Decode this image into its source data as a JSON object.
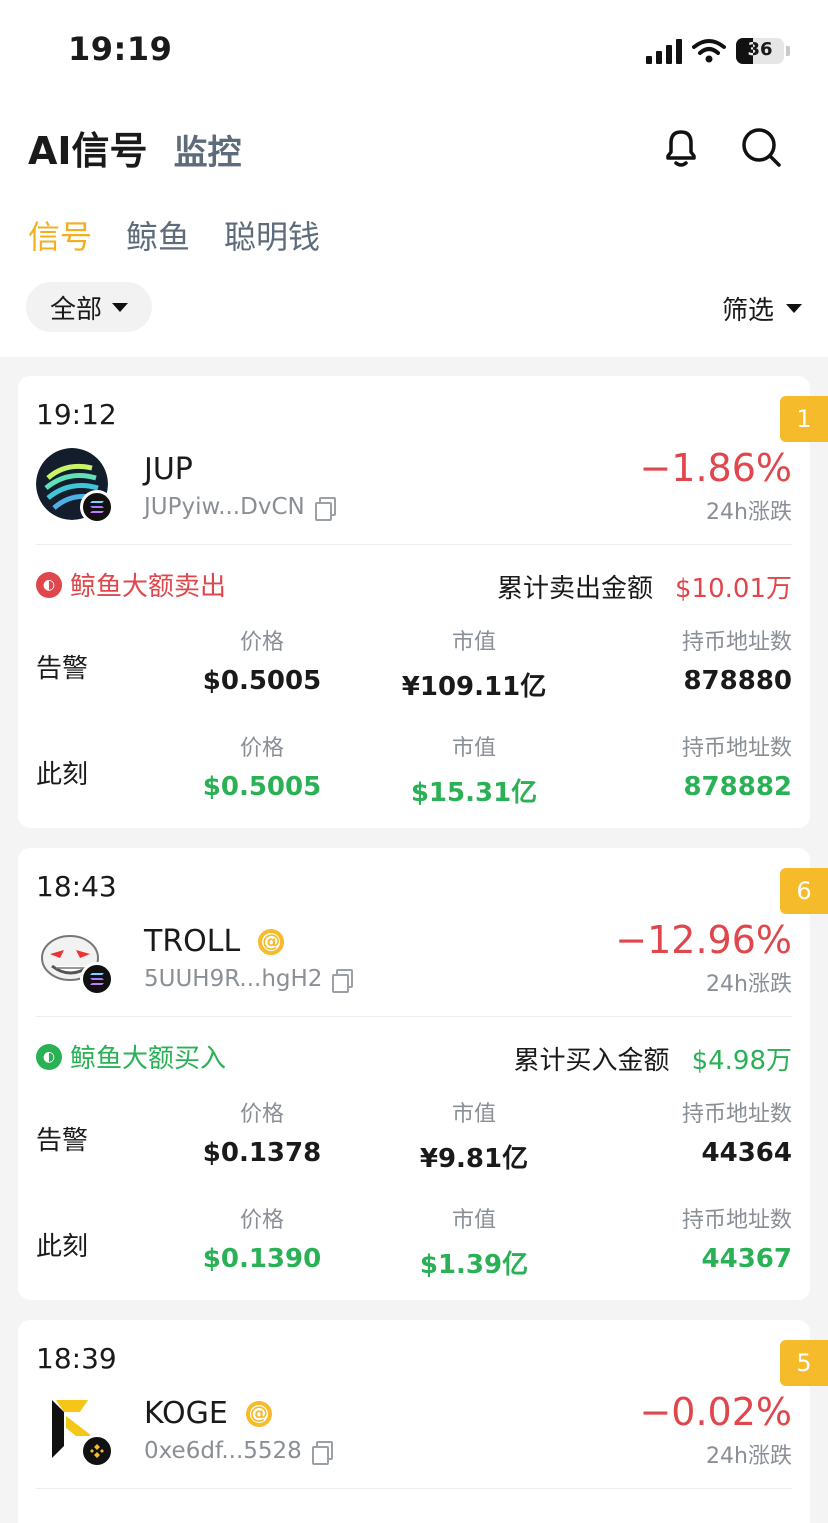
{
  "status_bar": {
    "time": "19:19",
    "battery": "36"
  },
  "header": {
    "title": "AI信号",
    "title_secondary": "监控"
  },
  "tabs": [
    {
      "label": "信号",
      "active": true
    },
    {
      "label": "鲸鱼"
    },
    {
      "label": "聪明钱"
    }
  ],
  "filter": {
    "scope": "全部",
    "filter_label": "筛选"
  },
  "colors": {
    "accent": "#f2b01e",
    "down": "#e0474c",
    "up": "#2ab155",
    "muted": "#8a8f96"
  },
  "cards": [
    {
      "time": "19:12",
      "badge": "1",
      "symbol": "JUP",
      "address": "JUPyiw...DvCN",
      "change": "−1.86%",
      "change_label": "24h涨跌",
      "alert_label": "鲸鱼大额卖出",
      "sum_label": "累计卖出金额",
      "sum_value": "$10.01万",
      "alert_row": {
        "label": "告警",
        "price_h": "价格",
        "price": "$0.5005",
        "mcap_h": "市值",
        "mcap": "¥109.11亿",
        "holders_h": "持币地址数",
        "holders": "878880"
      },
      "now_row": {
        "label": "此刻",
        "price_h": "价格",
        "price": "$0.5005",
        "mcap_h": "市值",
        "mcap": "$15.31亿",
        "holders_h": "持币地址数",
        "holders": "878882"
      }
    },
    {
      "time": "18:43",
      "badge": "6",
      "symbol": "TROLL",
      "address": "5UUH9R...hgH2",
      "change": "−12.96%",
      "change_label": "24h涨跌",
      "alert_label": "鲸鱼大额买入",
      "sum_label": "累计买入金额",
      "sum_value": "$4.98万",
      "alert_row": {
        "label": "告警",
        "price_h": "价格",
        "price": "$0.1378",
        "mcap_h": "市值",
        "mcap": "¥9.81亿",
        "holders_h": "持币地址数",
        "holders": "44364"
      },
      "now_row": {
        "label": "此刻",
        "price_h": "价格",
        "price": "$0.1390",
        "mcap_h": "市值",
        "mcap": "$1.39亿",
        "holders_h": "持币地址数",
        "holders": "44367"
      }
    },
    {
      "time": "18:39",
      "badge": "5",
      "symbol": "KOGE",
      "address": "0xe6df...5528",
      "change": "−0.02%",
      "change_label": "24h涨跌"
    }
  ]
}
